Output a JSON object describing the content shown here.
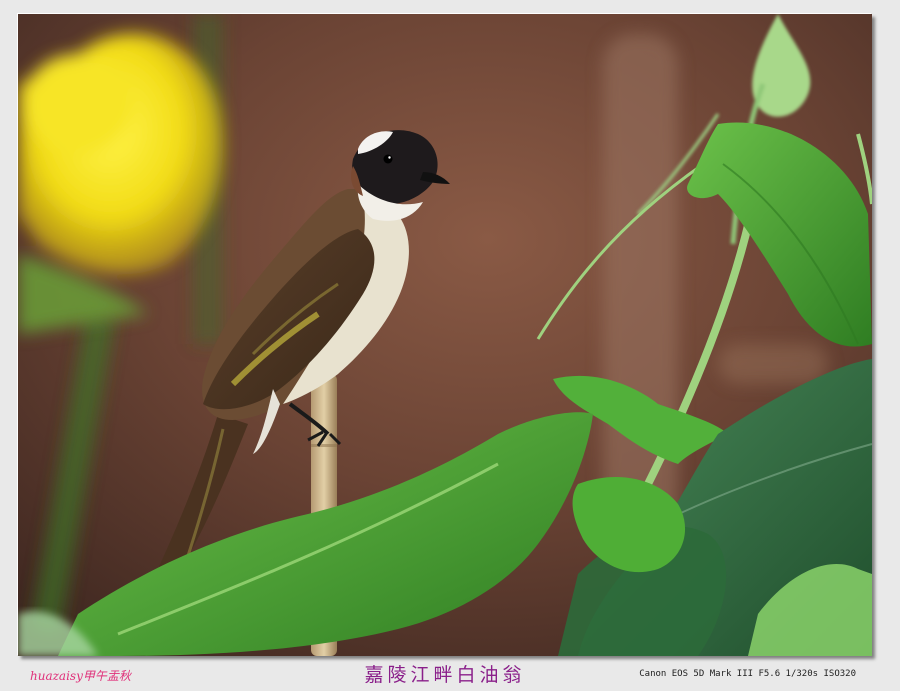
{
  "photo": {
    "subject": "bird-on-stalk",
    "colors": {
      "background_dark": "#4a2e25",
      "background_warm": "#7a5040",
      "flower_yellow": "#f4e21c",
      "leaf_green": "#3f9a2e",
      "bird_brown": "#6b4c33",
      "bird_belly": "#e8e2cf"
    }
  },
  "caption": {
    "signature": "huazaisy甲午盂秋",
    "title": "嘉陵江畔白油翁",
    "exif": "Canon EOS 5D Mark III F5.6 1/320s ISO320"
  }
}
